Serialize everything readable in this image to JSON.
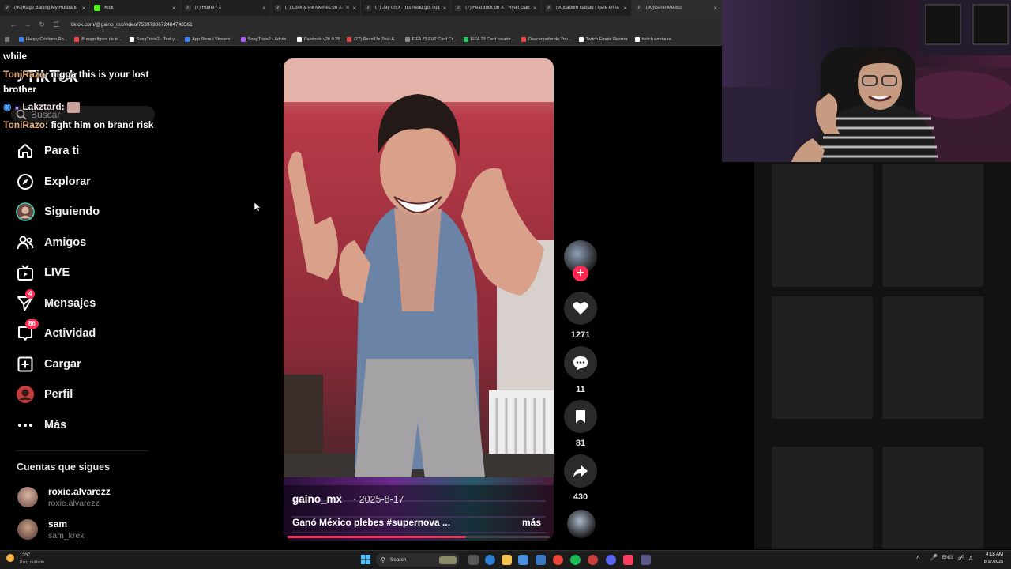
{
  "browser": {
    "tabs": [
      {
        "title": "(90)Rage Baiting My Husband",
        "color": "#ffffff"
      },
      {
        "title": "Kick",
        "color": "#53fc18"
      },
      {
        "title": "(7) Home / X",
        "color": "#ffffff"
      },
      {
        "title": "(7) Liberty Pill Memes on X: \"Is",
        "color": "#ffffff"
      },
      {
        "title": "(7) Jay on X: \"his head got flipp",
        "color": "#ffffff"
      },
      {
        "title": "(7) FearBuck on X: \"Ryan Garcia",
        "color": "#ffffff"
      },
      {
        "title": "(90)cabum cablau | fijate en la",
        "color": "#ffffff"
      },
      {
        "title": "(90)Ganó México",
        "color": "#ffffff"
      }
    ],
    "url": "tiktok.com/@gaino_mx/video/7539790672484748561",
    "bookmarks": [
      {
        "label": "Happy Cristiano Ro...",
        "color": "#3b82f6"
      },
      {
        "label": "Burago figura de to...",
        "color": "#ef4444"
      },
      {
        "label": "SongTrivia2 - Test y...",
        "color": "#ffffff"
      },
      {
        "label": "App Store / Streami...",
        "color": "#3b82f6"
      },
      {
        "label": "SongTrivia2 - Adivin...",
        "color": "#a855f7"
      },
      {
        "label": "Paletools v26.0.28",
        "color": "#ffffff"
      },
      {
        "label": "(77) Raco97s Zest-A...",
        "color": "#ef4444"
      },
      {
        "label": "FIFA 23 FUT Card Cr...",
        "color": "#888888"
      },
      {
        "label": "FIFA 23 Card creator...",
        "color": "#22c55e"
      },
      {
        "label": "Descargador de You...",
        "color": "#ef4444"
      },
      {
        "label": "Twitch Emote Resizer",
        "color": "#ffffff"
      },
      {
        "label": "twitch emote re...",
        "color": "#ffffff"
      }
    ]
  },
  "tiktok": {
    "logo": "TikTok",
    "search_placeholder": "Buscar",
    "nav": [
      {
        "label": "Para ti",
        "icon": "home-icon"
      },
      {
        "label": "Explorar",
        "icon": "compass-icon"
      },
      {
        "label": "Siguiendo",
        "icon": "avatar-icon"
      },
      {
        "label": "Amigos",
        "icon": "friends-icon"
      },
      {
        "label": "LIVE",
        "icon": "live-tv-icon"
      },
      {
        "label": "Mensajes",
        "icon": "send-icon",
        "badge": "4"
      },
      {
        "label": "Actividad",
        "icon": "inbox-icon",
        "badge": "86"
      },
      {
        "label": "Cargar",
        "icon": "plus-square-icon"
      },
      {
        "label": "Perfil",
        "icon": "profile-avatar-icon"
      },
      {
        "label": "Más",
        "icon": "more-dots-icon"
      }
    ],
    "following_title": "Cuentas que sigues",
    "following": [
      {
        "username": "roxie.alvarezz",
        "handle": "roxie.alvarezz"
      },
      {
        "username": "sam",
        "handle": "sam_krek"
      }
    ],
    "video": {
      "author": "gaino_mx",
      "date": "· 2025-8-17",
      "caption": "Ganó México plebes #supernova ...",
      "more": "más",
      "progress": 0.68
    },
    "actions": {
      "likes": "1271",
      "comments": "11",
      "saves": "81",
      "shares": "430"
    }
  },
  "chat": {
    "lines": [
      {
        "text": "while"
      },
      {
        "name": "ToniRazo",
        "text": ": nigga this is your lost"
      },
      {
        "text": "brother"
      },
      {
        "name": "Lakztard",
        "text": ":"
      },
      {
        "name": "ToniRazo",
        "text": ": fight him on brand risk"
      }
    ]
  },
  "taskbar": {
    "weather_temp": "13°C",
    "weather_desc": "Parc. nublado",
    "search": "Search",
    "lang": "ENG",
    "time": "4:18 AM",
    "date": "8/17/2025"
  }
}
